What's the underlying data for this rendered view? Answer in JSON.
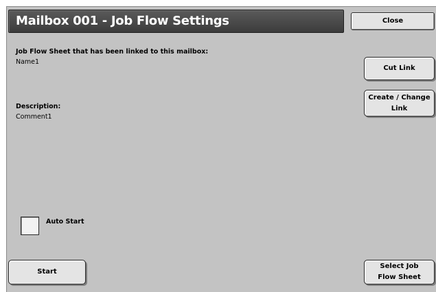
{
  "window": {
    "title": "Mailbox 001 - Job Flow Settings"
  },
  "toolbar": {
    "close_label": "Close"
  },
  "linked_sheet": {
    "heading": "Job Flow Sheet that has been linked to this mailbox:",
    "name": "Name1"
  },
  "description": {
    "heading": "Description:",
    "text": "Comment1"
  },
  "actions": {
    "cut_link_label": "Cut Link",
    "create_change_link_line1": "Create / Change",
    "create_change_link_line2": "Link",
    "start_label": "Start",
    "select_flow_sheet_line1": "Select Job",
    "select_flow_sheet_line2": "Flow Sheet"
  },
  "auto_start": {
    "label": "Auto Start",
    "checked": false
  }
}
